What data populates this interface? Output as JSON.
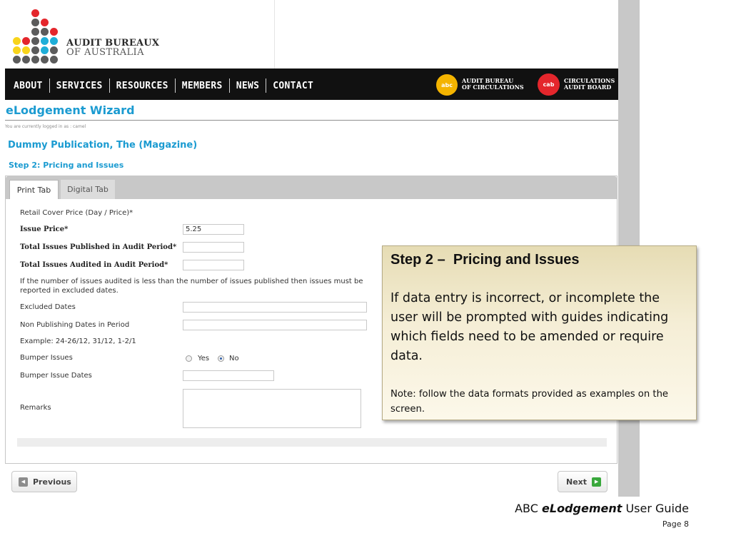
{
  "logo": {
    "line1": "AUDIT BUREAUX",
    "line2": "OF AUSTRALIA",
    "colors": {
      "red": "#e4262c",
      "yellow": "#f8d41b",
      "gray": "#5b5b5b",
      "cyan": "#1eaed8"
    }
  },
  "nav": {
    "items": [
      "ABOUT",
      "SERVICES",
      "RESOURCES",
      "MEMBERS",
      "NEWS",
      "CONTACT"
    ],
    "badges": [
      {
        "abbr": "abc",
        "text": "AUDIT BUREAU\nOF CIRCULATIONS",
        "color": "#f4b400"
      },
      {
        "abbr": "cab",
        "text": "CIRCULATIONS\nAUDIT BOARD",
        "color": "#e4262c"
      }
    ]
  },
  "page": {
    "title": "eLodgement Wizard",
    "login_line": "You are currently logged in as : camel",
    "publication": "Dummy Publication, The (Magazine)",
    "step": "Step 2: Pricing and Issues"
  },
  "tabs": [
    {
      "label": "Print Tab",
      "active": true
    },
    {
      "label": "Digital Tab",
      "active": false
    }
  ],
  "form": {
    "retail_cover_price": "Retail Cover Price (Day / Price)*",
    "issue_price_label": "Issue Price*",
    "issue_price_value": "5.25",
    "total_published_label": "Total Issues Published in Audit Period*",
    "total_audited_label": "Total Issues Audited in Audit Period*",
    "excluded_note_line1": "If the number of issues audited is less than the number of issues published then issues must be",
    "excluded_note_line2": "reported in excluded dates.",
    "excluded_dates_label": "Excluded Dates",
    "non_publishing_label": "Non Publishing Dates in Period",
    "example": "Example: 24-26/12, 31/12, 1-2/1",
    "bumper_issues_label": "Bumper Issues",
    "bumper_yes": "Yes",
    "bumper_no": "No",
    "bumper_selected": "No",
    "bumper_dates_label": "Bumper Issue Dates",
    "remarks_label": "Remarks"
  },
  "buttons": {
    "previous": "Previous",
    "next": "Next"
  },
  "callout": {
    "title": "Step 2 –  Pricing and Issues",
    "body": "If data entry is incorrect, or incomplete the user will be prompted with guides indicating which fields need to be amended or require data.",
    "note": "Note: follow the data formats provided as examples on the screen."
  },
  "footer": {
    "prefix": "ABC ",
    "brand": "eLodgement",
    "suffix": " User Guide",
    "page": "Page 8"
  }
}
